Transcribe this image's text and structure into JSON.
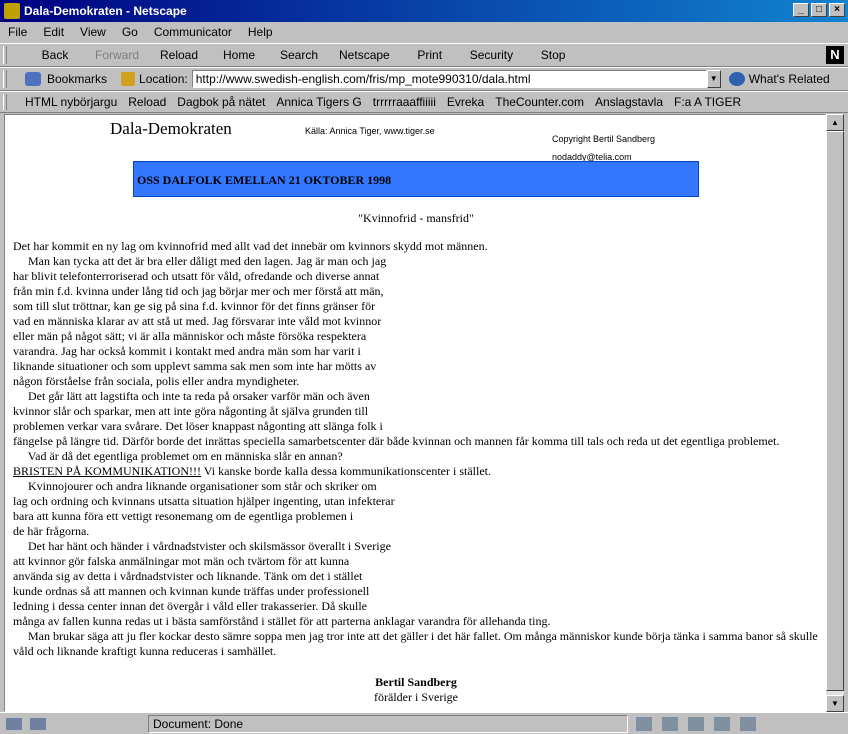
{
  "window": {
    "title": "Dala-Demokraten - Netscape"
  },
  "menu": [
    "File",
    "Edit",
    "View",
    "Go",
    "Communicator",
    "Help"
  ],
  "toolbar": {
    "buttons": [
      {
        "label": "Back",
        "enabled": true
      },
      {
        "label": "Forward",
        "enabled": false
      },
      {
        "label": "Reload",
        "enabled": true
      },
      {
        "label": "Home",
        "enabled": true
      },
      {
        "label": "Search",
        "enabled": true
      },
      {
        "label": "Netscape",
        "enabled": true
      },
      {
        "label": "Print",
        "enabled": true
      },
      {
        "label": "Security",
        "enabled": true
      },
      {
        "label": "Stop",
        "enabled": true
      }
    ]
  },
  "location": {
    "bookmarks_label": "Bookmarks",
    "location_label": "Location:",
    "url": "http://www.swedish-english.com/fris/mp_mote990310/dala.html",
    "related_label": "What's Related"
  },
  "personal_toolbar": [
    "HTML nybörjargu",
    "Reload",
    "Dagbok på nätet",
    "Annica Tigers G",
    "trrrrraaaffiiiii",
    "Evreka",
    "TheCounter.com",
    "Anslagstavla",
    "F:a A TIGER"
  ],
  "page": {
    "masthead": "Dala-Demokraten",
    "source": "Källa: Annica Tiger, www.tiger.se",
    "copyright": "Copyright Bertil Sandberg",
    "email": "nodaddy@telia.com",
    "banner": "OSS DALFOLK EMELLAN 21 OKTOBER 1998",
    "subtitle": "\"Kvinnofrid - mansfrid\"",
    "lines": [
      "Det har kommit en ny lag om kvinnofrid med allt vad det innebär om kvinnors skydd mot männen.",
      "     Man kan tycka att det är bra eller dåligt med den lagen. Jag är man och jag",
      "har blivit telefonterroriserad och utsatt för våld, ofredande och diverse annat",
      "från min f.d. kvinna under lång tid och jag börjar mer och mer förstå att män,",
      "som till slut tröttnar, kan ge sig på sina f.d. kvinnor för det finns gränser för",
      "vad en människa klarar av att stå ut med. Jag försvarar inte våld mot kvinnor",
      "eller män på något sätt; vi är alla människor och måste försöka respektera",
      "varandra. Jag har också kommit i kontakt med andra män som har varit i",
      "liknande situationer och som upplevt samma sak men som inte har mötts av",
      "någon förståelse från sociala, polis eller andra myndigheter.",
      "     Det går lätt att lagstifta och inte ta reda på orsaker varför män och även",
      "kvinnor slår och sparkar, men att inte göra någonting åt själva grunden till",
      "problemen verkar vara svårare. Det löser knappast någonting att slänga folk i",
      "fängelse på längre tid. Därför borde det inrättas speciella samarbetscenter där både kvinnan och mannen får komma till tals och reda ut det egentliga problemet.",
      "     Vad är då det egentliga problemet om en människa slår en annan?",
      "BRISTEN PÅ KOMMUNIKATION!!! Vi kanske borde kalla dessa kommunikationscenter i stället.",
      "     Kvinnojourer och andra liknande organisationer som står och skriker om",
      "lag och ordning och kvinnans utsatta situation hjälper ingenting, utan infekterar",
      "bara att kunna föra ett vettigt resonemang om de egentliga problemen i",
      "de här frågorna.",
      "     Det har hänt och händer i vårdnadstvister och skilsmässor överallt i Sverige",
      "att kvinnor gör falska anmälningar mot män och tvärtom för att kunna",
      "använda sig av detta i vårdnadstvister och liknande. Tänk om det i stället",
      "kunde ordnas så att mannen och kvinnan kunde träffas under professionell",
      "ledning i dessa center innan det övergår i våld eller trakasserier. Då skulle",
      "många av fallen kunna redas ut i bästa samförstånd i stället för att parterna anklagar varandra för allehanda ting.",
      "     Man brukar säga att ju fler kockar desto sämre soppa men jag tror inte att det gäller i det här fallet. Om många människor kunde börja tänka i samma banor så skulle",
      "våld och liknande kraftigt kunna reduceras i samhället."
    ],
    "underline_prefix": "BRISTEN PÅ KOMMUNIKATION!!!",
    "signature_name": "Bertil Sandberg",
    "signature_role": "förälder i Sverige"
  },
  "status": {
    "text": "Document: Done"
  }
}
